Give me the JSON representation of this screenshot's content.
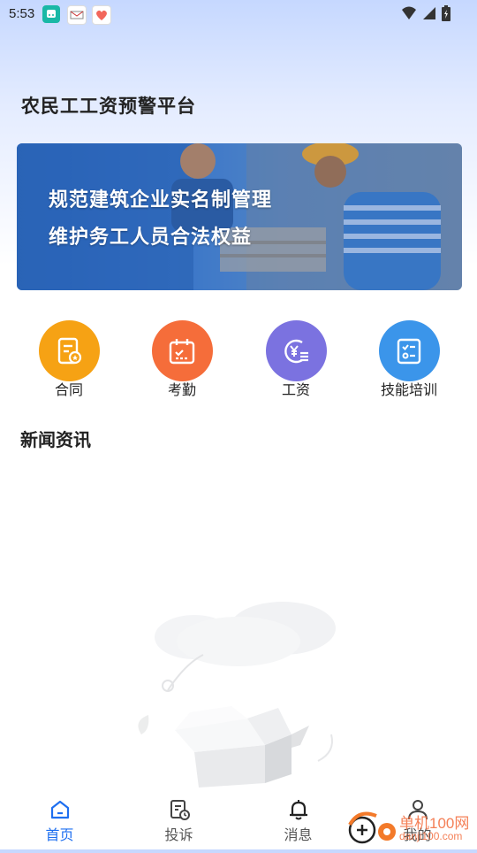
{
  "status_bar": {
    "time": "5:53",
    "icons": [
      "app-notification-icon",
      "mail-icon",
      "health-app-icon",
      "wifi-icon",
      "cellular-signal-icon",
      "battery-icon"
    ]
  },
  "header": {
    "title": "农民工工资预警平台"
  },
  "banner": {
    "line1": "规范建筑企业实名制管理",
    "line2": "维护务工人员合法权益"
  },
  "quick_actions": [
    {
      "label": "合同",
      "icon": "contract-icon",
      "color": "#f6a214"
    },
    {
      "label": "考勤",
      "icon": "calendar-icon",
      "color": "#f56d3a"
    },
    {
      "label": "工资",
      "icon": "salary-icon",
      "color": "#7b72e0"
    },
    {
      "label": "技能培训",
      "icon": "checklist-icon",
      "color": "#3b95ea"
    }
  ],
  "news": {
    "title": "新闻资讯"
  },
  "bottom_nav": {
    "items": [
      {
        "label": "首页",
        "icon": "home-icon"
      },
      {
        "label": "投诉",
        "icon": "complaint-icon"
      },
      {
        "label": "消息",
        "icon": "bell-icon"
      },
      {
        "label": "我的",
        "icon": "user-icon"
      }
    ],
    "active_color": "#1e6ff0"
  },
  "watermark": {
    "text": "单机100网",
    "sub": "danji100.com"
  }
}
